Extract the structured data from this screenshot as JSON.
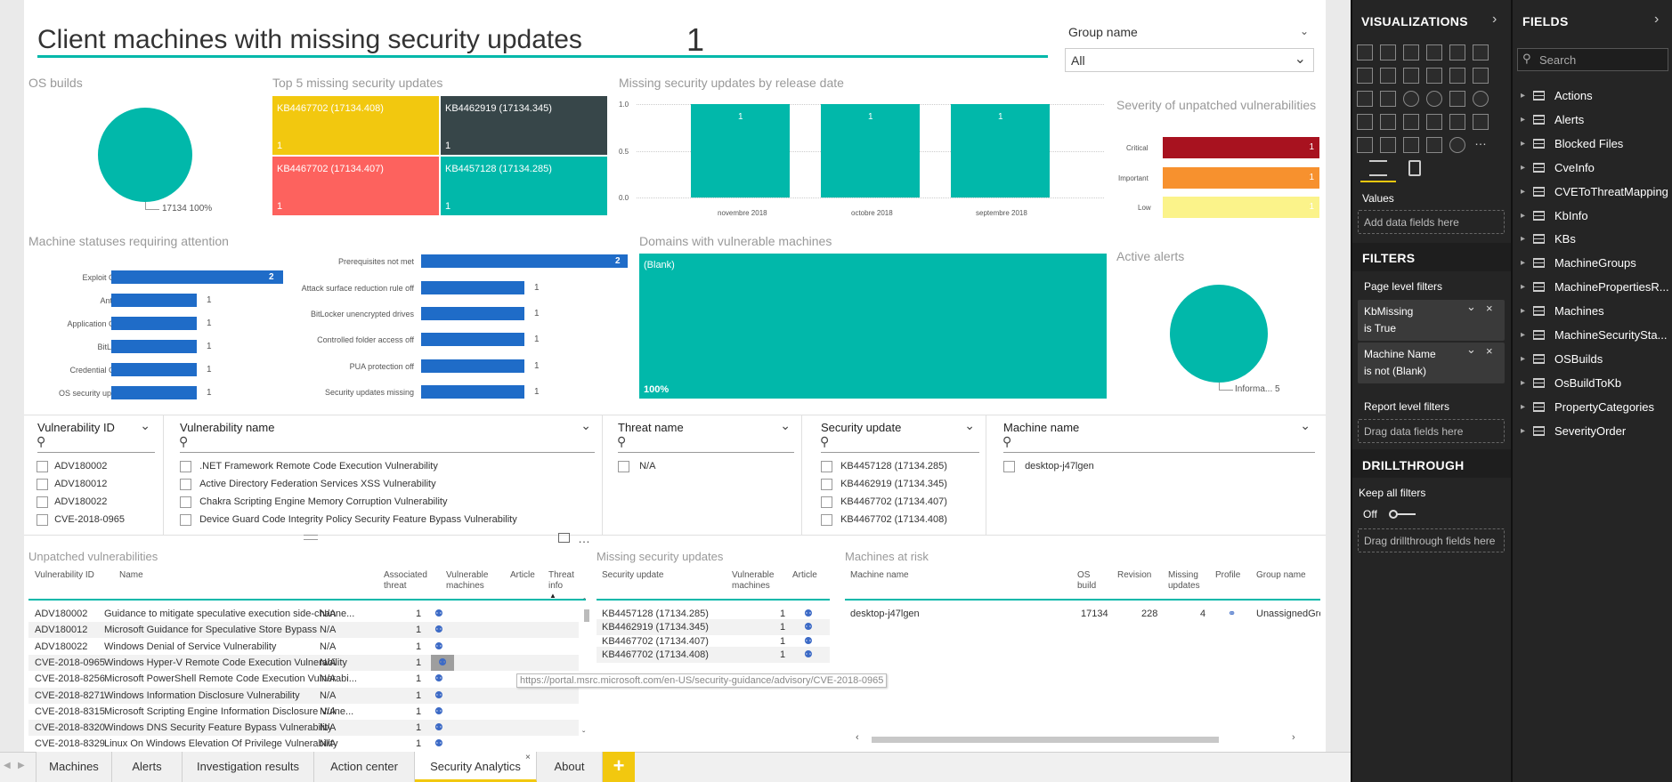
{
  "header": {
    "title": "Client machines with missing security updates",
    "count": "1",
    "group_label": "Group name",
    "group_value": "All"
  },
  "os_builds": {
    "title": "OS builds",
    "label": "17134 100%"
  },
  "top5": {
    "title": "Top 5 missing security updates",
    "tiles": [
      {
        "label": "KB4467702 (17134.408)",
        "value": "1",
        "color": "#f2c80f"
      },
      {
        "label": "KB4462919 (17134.345)",
        "value": "1",
        "color": "#374649"
      },
      {
        "label": "KB4467702 (17134.407)",
        "value": "1",
        "color": "#fd625e"
      },
      {
        "label": "KB4457128 (17134.285)",
        "value": "1",
        "color": "#01b8aa"
      }
    ]
  },
  "release_date": {
    "title": "Missing security updates by release date",
    "y_ticks": [
      "1.0",
      "0.5",
      "0.0"
    ],
    "months": [
      "novembre 2018",
      "octobre 2018",
      "septembre 2018"
    ],
    "values": [
      "1",
      "1",
      "1"
    ]
  },
  "severity": {
    "title": "Severity of unpatched vulnerabilities",
    "items": [
      {
        "label": "Critical",
        "value": "1",
        "color": "#a8121f"
      },
      {
        "label": "Important",
        "value": "1",
        "color": "#f7912e"
      },
      {
        "label": "Low",
        "value": "1",
        "color": "#fbf38a"
      }
    ]
  },
  "machine_statuses": {
    "title": "Machine statuses requiring attention",
    "left": [
      {
        "label": "Exploit Guard",
        "value": "2"
      },
      {
        "label": "Antivirus",
        "value": "1"
      },
      {
        "label": "Application Guard",
        "value": "1"
      },
      {
        "label": "BitLocker",
        "value": "1"
      },
      {
        "label": "Credential Guard",
        "value": "1"
      },
      {
        "label": "OS security updates",
        "value": "1"
      }
    ],
    "right": [
      {
        "label": "Prerequisites not met",
        "value": "2"
      },
      {
        "label": "Attack surface reduction rule off",
        "value": "1"
      },
      {
        "label": "BitLocker unencrypted drives",
        "value": "1"
      },
      {
        "label": "Controlled folder access off",
        "value": "1"
      },
      {
        "label": "PUA protection off",
        "value": "1"
      },
      {
        "label": "Security updates missing",
        "value": "1"
      }
    ]
  },
  "domains": {
    "title": "Domains with vulnerable machines",
    "blank_label": "(Blank)",
    "percent": "100%"
  },
  "active_alerts": {
    "title": "Active alerts",
    "label": "Informa... 5"
  },
  "slicers": {
    "vuln_id": {
      "title": "Vulnerability ID",
      "items": [
        "ADV180002",
        "ADV180012",
        "ADV180022",
        "CVE-2018-0965"
      ]
    },
    "vuln_name": {
      "title": "Vulnerability name",
      "items": [
        ".NET Framework Remote Code Execution Vulnerability",
        "Active Directory Federation Services XSS Vulnerability",
        "Chakra Scripting Engine Memory Corruption Vulnerability",
        "Device Guard Code Integrity Policy Security Feature Bypass Vulnerability"
      ]
    },
    "threat": {
      "title": "Threat name",
      "items": [
        "N/A"
      ]
    },
    "sec_update": {
      "title": "Security update",
      "items": [
        "KB4457128 (17134.285)",
        "KB4462919 (17134.345)",
        "KB4467702 (17134.407)",
        "KB4467702 (17134.408)"
      ]
    },
    "machine": {
      "title": "Machine name",
      "items": [
        "desktop-j47lgen"
      ]
    }
  },
  "unpatched": {
    "title": "Unpatched vulnerabilities",
    "headers": [
      "Vulnerability ID",
      "Name",
      "Associated threat",
      "Vulnerable machines",
      "Article",
      "Threat info"
    ],
    "rows": [
      [
        "ADV180002",
        "Guidance to mitigate speculative execution side-channe...",
        "N/A",
        "1"
      ],
      [
        "ADV180012",
        "Microsoft Guidance for Speculative Store Bypass",
        "N/A",
        "1"
      ],
      [
        "ADV180022",
        "Windows Denial of Service Vulnerability",
        "N/A",
        "1"
      ],
      [
        "CVE-2018-0965",
        "Windows Hyper-V Remote Code Execution Vulnerability",
        "N/A",
        "1"
      ],
      [
        "CVE-2018-8256",
        "Microsoft PowerShell Remote Code Execution Vulnerabi...",
        "N/A",
        "1"
      ],
      [
        "CVE-2018-8271",
        "Windows Information Disclosure Vulnerability",
        "N/A",
        "1"
      ],
      [
        "CVE-2018-8315",
        "Microsoft Scripting Engine Information Disclosure Vulne...",
        "N/A",
        "1"
      ],
      [
        "CVE-2018-8320",
        "Windows DNS Security Feature Bypass Vulnerability",
        "N/A",
        "1"
      ],
      [
        "CVE-2018-8329",
        "Linux On Windows Elevation Of Privilege Vulnerability",
        "N/A",
        "1"
      ]
    ],
    "tooltip": "https://portal.msrc.microsoft.com/en-US/security-guidance/advisory/CVE-2018-0965"
  },
  "missing_updates": {
    "title": "Missing security updates",
    "headers": [
      "Security update",
      "Vulnerable machines",
      "Article"
    ],
    "rows": [
      [
        "KB4457128 (17134.285)",
        "1"
      ],
      [
        "KB4462919 (17134.345)",
        "1"
      ],
      [
        "KB4467702 (17134.407)",
        "1"
      ],
      [
        "KB4467702 (17134.408)",
        "1"
      ]
    ]
  },
  "machines_risk": {
    "title": "Machines at risk",
    "headers": [
      "Machine name",
      "OS build",
      "Revision",
      "Missing updates",
      "Profile",
      "Group name"
    ],
    "row": [
      "desktop-j47lgen",
      "17134",
      "228",
      "4",
      "",
      "UnassignedGro"
    ]
  },
  "tabs": [
    "Machines",
    "Alerts",
    "Investigation results",
    "Action center",
    "Security Analytics",
    "About"
  ],
  "active_tab": "Security Analytics",
  "visualizations": {
    "title": "VISUALIZATIONS",
    "values_label": "Values",
    "add_fields": "Add data fields here"
  },
  "filters": {
    "title": "FILTERS",
    "page_level": "Page level filters",
    "cards": [
      {
        "name": "KbMissing",
        "cond": "is True"
      },
      {
        "name": "Machine Name",
        "cond": "is not (Blank)"
      }
    ],
    "report_level": "Report level filters",
    "drag_fields": "Drag data fields here"
  },
  "drillthrough": {
    "title": "DRILLTHROUGH",
    "keep_all": "Keep all filters",
    "off": "Off",
    "drag": "Drag drillthrough fields here"
  },
  "fields": {
    "title": "FIELDS",
    "search_placeholder": "Search",
    "items": [
      "Actions",
      "Alerts",
      "Blocked Files",
      "CveInfo",
      "CVEToThreatMapping",
      "KbInfo",
      "KBs",
      "MachineGroups",
      "MachinePropertiesR...",
      "Machines",
      "MachineSecuritySta...",
      "OSBuilds",
      "OsBuildToKb",
      "PropertyCategories",
      "SeverityOrder"
    ]
  }
}
